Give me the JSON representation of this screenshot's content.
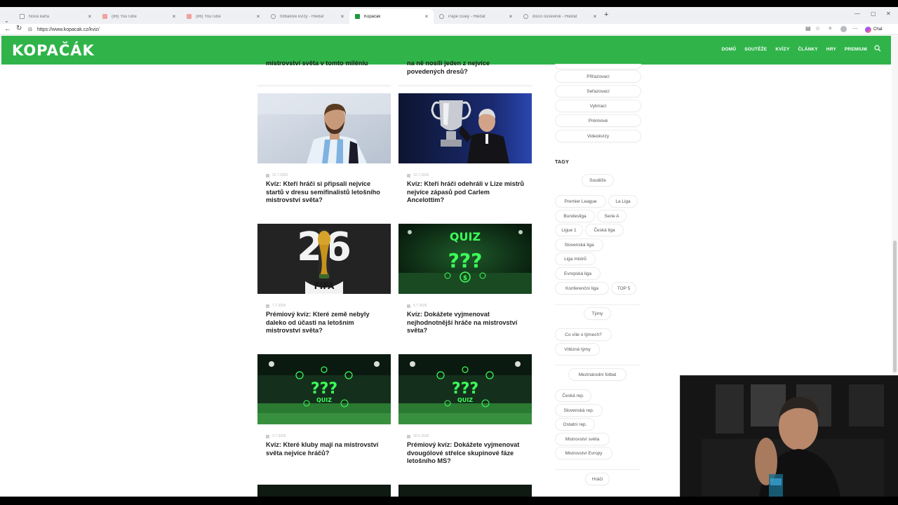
{
  "browser": {
    "tabs": [
      {
        "label": "Nová karta",
        "favicon": "doc",
        "active": false
      },
      {
        "label": "(86) YouTube",
        "favicon": "youtube",
        "active": false
      },
      {
        "label": "(86) YouTube",
        "favicon": "youtube",
        "active": false
      },
      {
        "label": "fotbalové kvízy - Hledat",
        "favicon": "search",
        "active": false
      },
      {
        "label": "Kopačák",
        "favicon": "kopacak",
        "active": true
      },
      {
        "label": "Pape Guey - Hledat",
        "favicon": "search",
        "active": false
      },
      {
        "label": "disco oušewnik - Hledat",
        "favicon": "search",
        "active": false
      }
    ],
    "url": "https://www.kopacak.cz/kviz/",
    "chat_label": "Chat"
  },
  "site": {
    "logo": "KOPAČÁK",
    "nav": [
      "DOMŮ",
      "SOUTĚŽE",
      "KVÍZY",
      "ČLÁNKY",
      "HRY",
      "PREMIUM"
    ],
    "accent": "#30b44a"
  },
  "partial_titles": {
    "left": "mistrovství světa v tomto miléniu",
    "right_line1": "na ně nosili jeden z nejvíce",
    "right_line2": "povedených dresů?"
  },
  "articles": [
    {
      "date": "12.7.2026",
      "title": "Kvíz: Kteří hráči si připsali nejvíce startů v dresu semifinalistů letošního mistrovství světa?"
    },
    {
      "date": "10.7.2026",
      "title": "Kvíz: Kteří hráči odehráli v Lize mistrů nejvíce zápasů pod Carlem Ancelottim?"
    },
    {
      "date": "7.7.2026",
      "title": "Prémiový kvíz: Které země nebyly daleko od účasti na letošním mistrovství světa?"
    },
    {
      "date": "5.7.2026",
      "title": "Kvíz: Dokážete vyjmenovat nejhodnotnější hráče na mistrovství světa?"
    },
    {
      "date": "3.7.2026",
      "title": "Kvíz: Které kluby mají na mistrovství světa nejvíce hráčů?"
    },
    {
      "date": "30.6.2026",
      "title": "Prémiový kvíz: Dokážete vyjmenovat dvougólové střelce skupinové fáze letošního MS?"
    }
  ],
  "image_text": {
    "fifa": "FIFA",
    "quiz": "QUIZ"
  },
  "sidebar": {
    "categories": [
      "Přiřazovací",
      "Seřazovací",
      "Vybírací",
      "Prémiové",
      "Videokvízy"
    ],
    "tags_heading": "TAGY",
    "tag_groups": [
      {
        "title": "Soutěže",
        "items": [
          "Premier League",
          "La Liga",
          "Bundesliga",
          "Serie A",
          "Ligue 1",
          "Česká liga",
          "Slovenská liga",
          "Liga mistrů",
          "Evropská liga",
          "Konferenční liga",
          "TOP 5"
        ]
      },
      {
        "title": "Týmy",
        "items": [
          "Co víte o týmech?",
          "Vítězné týmy"
        ]
      },
      {
        "title": "Mezinárodní fotbal",
        "items": [
          "Česká rep.",
          "Slovenská rep.",
          "Ostatní rep.",
          "Mistrovství světa",
          "Mistrovství Evropy"
        ]
      },
      {
        "title": "Hráči",
        "items": []
      }
    ]
  }
}
